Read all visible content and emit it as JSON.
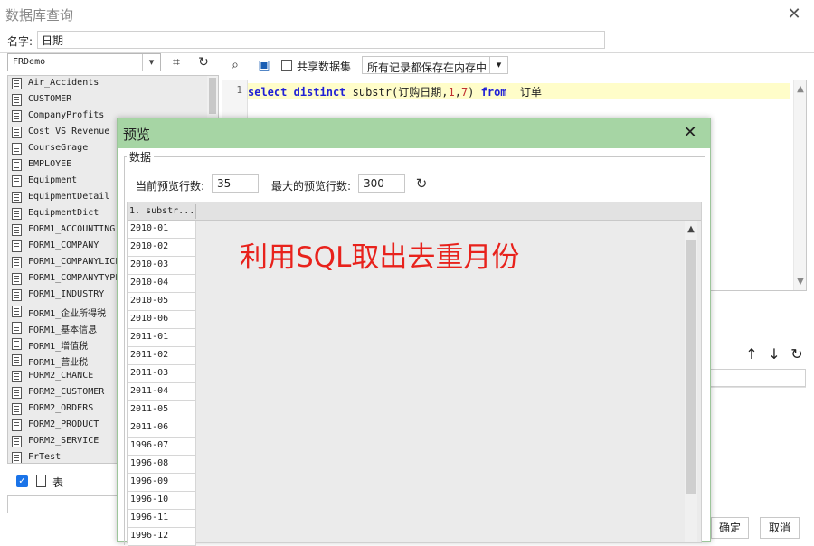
{
  "window": {
    "title": "数据库查询"
  },
  "name_row": {
    "label": "名字:",
    "value": "日期"
  },
  "left_panel": {
    "datasource": "FRDemo",
    "tables": [
      "Air_Accidents",
      "CUSTOMER",
      "CompanyProfits",
      "Cost_VS_Revenue",
      "CourseGrage",
      "EMPLOYEE",
      "Equipment",
      "EquipmentDetail",
      "EquipmentDict",
      "FORM1_ACCOUNTING",
      "FORM1_COMPANY",
      "FORM1_COMPANYLICE",
      "FORM1_COMPANYTYPE",
      "FORM1_INDUSTRY",
      "FORM1_企业所得税",
      "FORM1_基本信息",
      "FORM1_增值税",
      "FORM1_营业税",
      "FORM2_CHANCE",
      "FORM2_CUSTOMER",
      "FORM2_ORDERS",
      "FORM2_PRODUCT",
      "FORM2_SERVICE",
      "FrTest"
    ],
    "table_checkbox_label": "表"
  },
  "editor": {
    "share_label": "共享数据集",
    "cache_mode": "所有记录都保存在内存中",
    "line_number": "1",
    "sql": {
      "kw_select": "select",
      "kw_distinct": "distinct",
      "fn": "substr",
      "arg_col": "订购日期",
      "arg_start": "1",
      "arg_len": "7",
      "kw_from": "from",
      "table": "订单"
    }
  },
  "footer": {
    "ok": "确定",
    "cancel": "取消"
  },
  "preview": {
    "title": "预览",
    "group_label": "数据",
    "current_rows_label": "当前预览行数:",
    "current_rows": "35",
    "max_rows_label": "最大的预览行数:",
    "max_rows": "300",
    "column_header": "1. substr...",
    "rows": [
      "2010-01",
      "2010-02",
      "2010-03",
      "2010-04",
      "2010-05",
      "2010-06",
      "2011-01",
      "2011-02",
      "2011-03",
      "2011-04",
      "2011-05",
      "2011-06",
      "1996-07",
      "1996-08",
      "1996-09",
      "1996-10",
      "1996-11",
      "1996-12"
    ],
    "annotation": "利用SQL取出去重月份"
  },
  "colors": {
    "dialog_title": "#a6d5a4",
    "annotation": "#e8221c",
    "keyword": "#1f1fd6",
    "number": "#c03030"
  }
}
